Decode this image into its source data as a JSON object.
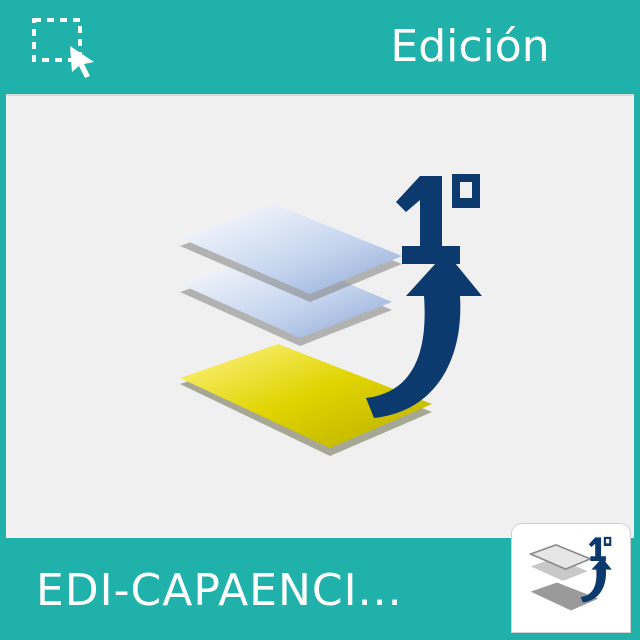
{
  "header": {
    "title": "Edición",
    "select_icon": "dashed-selection-cursor-icon"
  },
  "preview": {
    "icon": "layers-bring-to-front-icon",
    "icon_text": "1ª"
  },
  "footer": {
    "label": "EDI-CAPAENCI...",
    "badge_icon": "layers-bring-to-front-icon"
  },
  "colors": {
    "teal": "#20b2aa",
    "preview_bg": "#f0f0f0",
    "arrow_blue": "#0d3a6e",
    "layer_yellow": "#d4c800",
    "layer_blue": "#c9d8ee"
  }
}
